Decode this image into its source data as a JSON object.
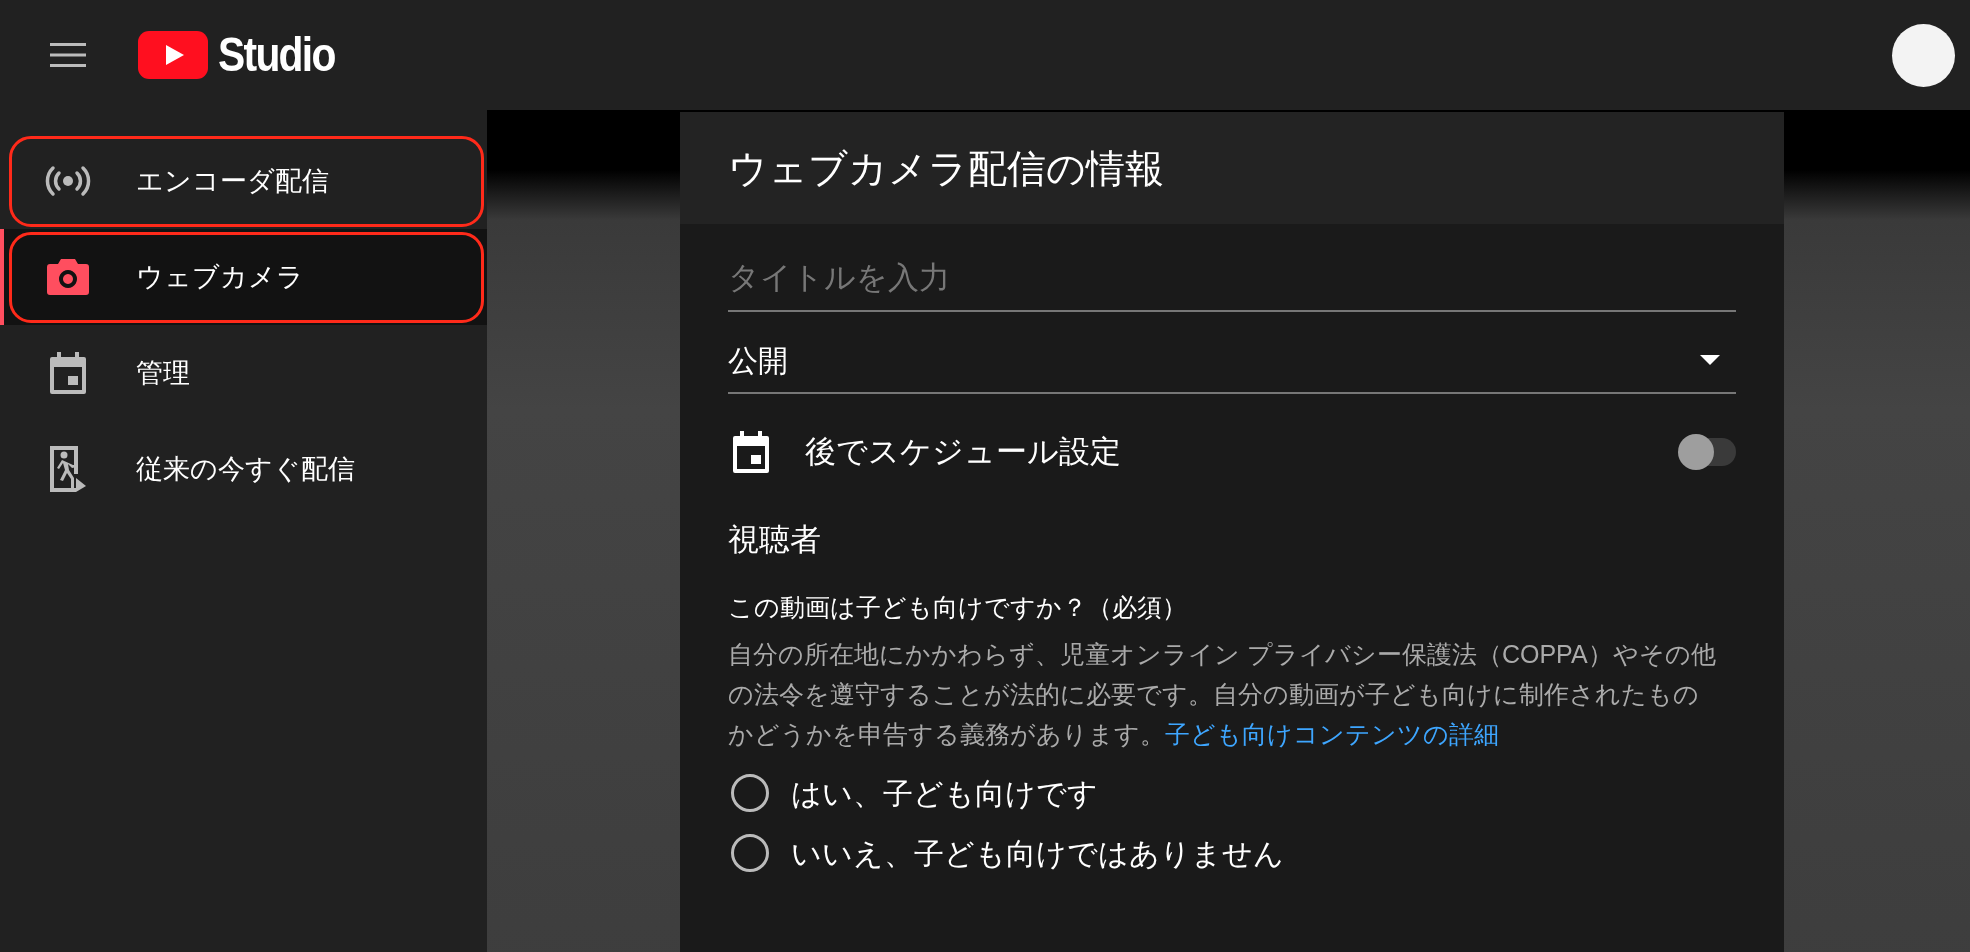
{
  "header": {
    "logo_text": "Studio"
  },
  "sidebar": {
    "items": [
      {
        "kind": "broadcast",
        "label": "エンコーダ配信",
        "selected": false,
        "highlighted": true
      },
      {
        "kind": "camera",
        "label": "ウェブカメラ",
        "selected": true,
        "highlighted": true
      },
      {
        "kind": "calendar",
        "label": "管理",
        "selected": false,
        "highlighted": false
      },
      {
        "kind": "exit",
        "label": "従来の今すぐ配信",
        "selected": false,
        "highlighted": false
      }
    ]
  },
  "dialog": {
    "title": "ウェブカメラ配信の情報",
    "title_field": {
      "placeholder": "タイトルを入力"
    },
    "visibility_select": {
      "value": "公開"
    },
    "schedule": {
      "label": "後でスケジュール設定",
      "on": false
    },
    "audience": {
      "heading": "視聴者",
      "question": "この動画は子ども向けですか？（必須）",
      "description": "自分の所在地にかかわらず、児童オンライン プライバシー保護法（COPPA）やその他の法令を遵守することが法的に必要です。自分の動画が子ども向けに制作されたものかどうかを申告する義務があります。",
      "link": "子ども向けコンテンツの詳細",
      "options": [
        {
          "label": "はい、子ども向けです",
          "selected": false
        },
        {
          "label": "いいえ、子ども向けではありません",
          "selected": false
        }
      ]
    }
  }
}
